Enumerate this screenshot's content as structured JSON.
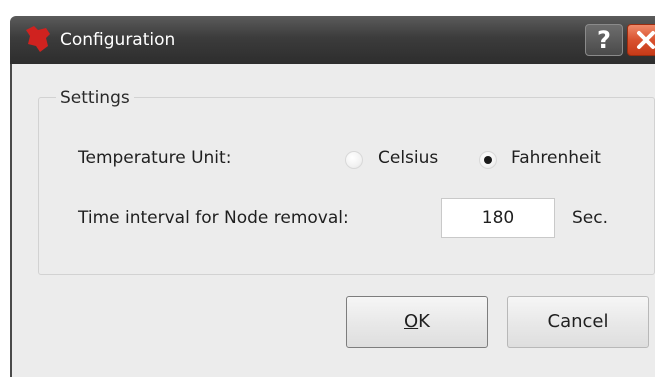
{
  "window": {
    "title": "Configuration",
    "help_label": "?",
    "close_label": ""
  },
  "settings": {
    "group_title": "Settings",
    "temperature_label": "Temperature Unit:",
    "temperature_options": [
      "Celsius",
      "Fahrenheit"
    ],
    "temperature_selected": "Fahrenheit",
    "interval_label": "Time interval for Node removal:",
    "interval_value": "180",
    "interval_unit": "Sec."
  },
  "buttons": {
    "ok_mnemonic": "O",
    "ok_rest": "K",
    "cancel_label": "Cancel"
  },
  "colors": {
    "close_button": "#d9522f",
    "title_bar": "#3c3c3c",
    "dialog_background": "#ececec"
  }
}
